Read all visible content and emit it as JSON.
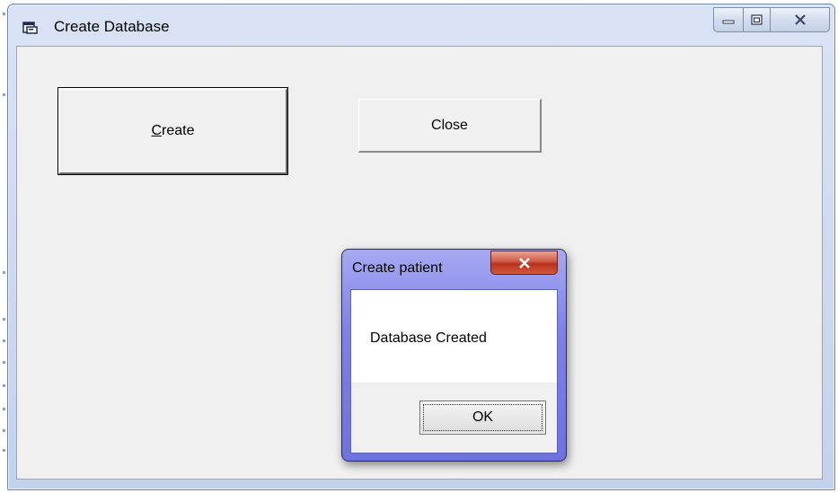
{
  "window": {
    "title": "Create Database",
    "icon": "form-icon",
    "caption_buttons": {
      "minimize_icon": "minimize-icon",
      "maximize_icon": "maximize-icon",
      "close_icon": "close-icon"
    }
  },
  "form": {
    "create_button_label": "Create",
    "close_button_label": "Close"
  },
  "message_box": {
    "title": "Create patient",
    "message": "Database Created",
    "ok_label": "OK",
    "close_glyph": "x"
  },
  "colors": {
    "client_background": "#f0f0f0",
    "dialog_frame": "#7c80e8",
    "close_button": "#c0392b"
  }
}
